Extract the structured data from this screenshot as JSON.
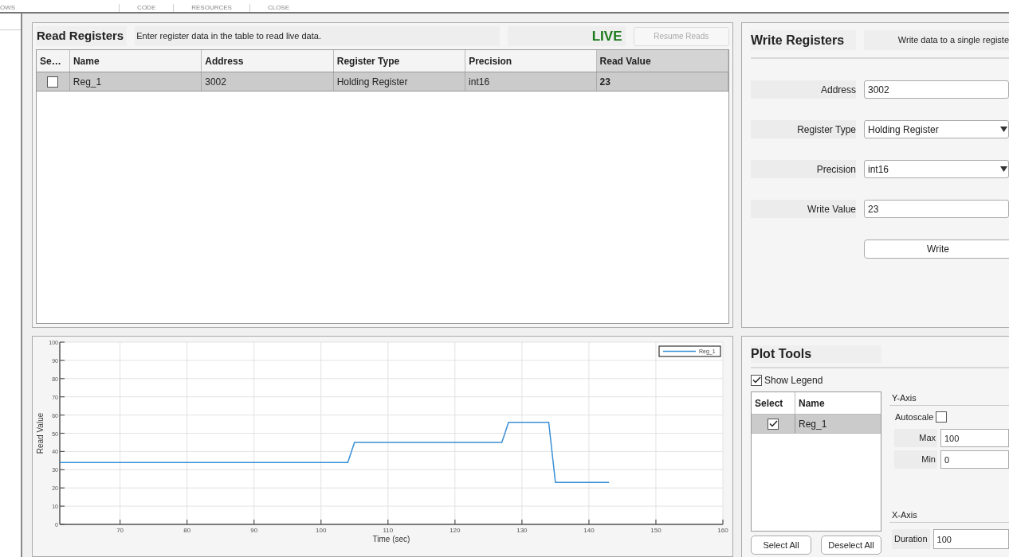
{
  "top_tabs": [
    "OWS",
    "CODE",
    "RESOURCES",
    "CLOSE"
  ],
  "read_registers": {
    "title": "Read Registers",
    "hint": "Enter register data in the table to read live data.",
    "status": "LIVE",
    "resume_button": {
      "label": "Resume Reads",
      "disabled": true
    },
    "table": {
      "select_column": "Se…",
      "columns": [
        "Name",
        "Address",
        "Register Type",
        "Precision",
        "Read Value"
      ],
      "rows": [
        {
          "selected": true,
          "checked": false,
          "cells": [
            "Reg_1",
            "3002",
            "Holding Register",
            "int16",
            "23"
          ]
        }
      ]
    }
  },
  "chart": {
    "chart_data": {
      "type": "line",
      "xlabel": "Time (sec)",
      "ylabel": "Read Value",
      "x": [
        61,
        104,
        105,
        127,
        128,
        134,
        135,
        143
      ],
      "series": [
        {
          "name": "Reg_1",
          "color": "#3a8fd4",
          "values": [
            34,
            34,
            45,
            45,
            56,
            56,
            23,
            23
          ]
        }
      ],
      "grid": true,
      "xlim": [
        61,
        160
      ],
      "ylim": [
        0,
        100
      ],
      "xticks": [
        70,
        80,
        90,
        100,
        110,
        120,
        130,
        140,
        150,
        160
      ],
      "yticks": [
        0,
        10,
        20,
        30,
        40,
        50,
        60,
        70,
        80,
        90,
        100
      ]
    }
  },
  "write_registers": {
    "title": "Write Registers",
    "hint": "Write data to a single registe",
    "fields": [
      {
        "label": "Address",
        "value": "3002",
        "kind": "text"
      },
      {
        "label": "Register Type",
        "value": "Holding Register",
        "kind": "dropdown"
      },
      {
        "label": "Precision",
        "value": "int16",
        "kind": "dropdown"
      },
      {
        "label": "Write Value",
        "value": "23",
        "kind": "text"
      }
    ],
    "write_button": "Write"
  },
  "plot_tools": {
    "title": "Plot Tools",
    "show_legend": {
      "label": "Show Legend",
      "checked": true
    },
    "table": {
      "columns": [
        "Select",
        "Name"
      ],
      "rows": [
        {
          "selected": true,
          "checked": true,
          "name": "Reg_1"
        }
      ]
    },
    "buttons": [
      "Select All",
      "Deselect All"
    ],
    "y_axis": {
      "title": "Y-Axis",
      "autoscale": {
        "label": "Autoscale",
        "checked": false
      },
      "max": {
        "label": "Max",
        "value": "100"
      },
      "min": {
        "label": "Min",
        "value": "0"
      }
    },
    "x_axis": {
      "title": "X-Axis",
      "duration": {
        "label": "Duration",
        "value": "100"
      }
    }
  }
}
